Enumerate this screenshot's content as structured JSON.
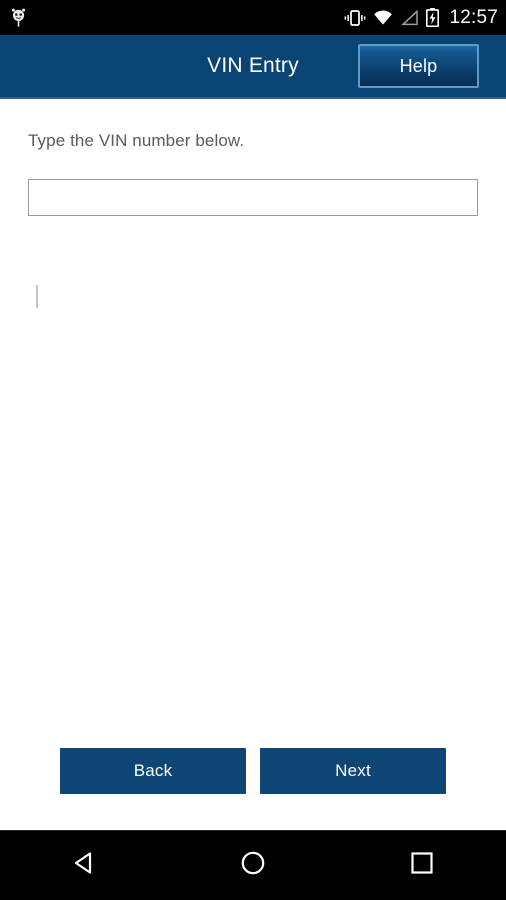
{
  "status_bar": {
    "notification_icon": "android-robot-icon",
    "icons": [
      "vibrate-icon",
      "wifi-icon",
      "cell-signal-icon",
      "battery-charging-icon"
    ],
    "time": "12:57"
  },
  "header": {
    "title": "VIN Entry",
    "help_label": "Help",
    "background_color": "#0a4474",
    "border_color": "#5b9ccb"
  },
  "main": {
    "instruction": "Type the VIN number below.",
    "vin_input": {
      "value": "",
      "placeholder": ""
    }
  },
  "footer": {
    "back_label": "Back",
    "next_label": "Next",
    "button_color": "#0e4574"
  },
  "navigation_bar": {
    "back": "back-triangle-icon",
    "home": "home-circle-icon",
    "recents": "recents-square-icon"
  }
}
